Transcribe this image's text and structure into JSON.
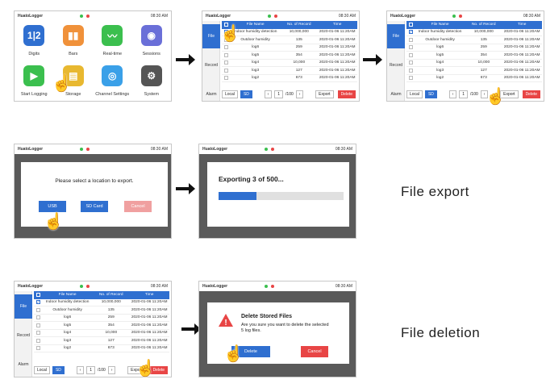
{
  "status": {
    "brand": "HuatoLogger",
    "time": "08:30 AM"
  },
  "home": {
    "apps": [
      {
        "label": "Digits",
        "glyph": "1|2",
        "color": "#2f6fd0"
      },
      {
        "label": "Bars",
        "glyph": "▮▮",
        "color": "#f0913a"
      },
      {
        "label": "Real-time",
        "glyph": "〰",
        "color": "#3bbf4e"
      },
      {
        "label": "Sessions",
        "glyph": "◉",
        "color": "#6a6fd8"
      },
      {
        "label": "Start Logging",
        "glyph": "▶",
        "color": "#3bbf4e"
      },
      {
        "label": "Storage",
        "glyph": "▤",
        "color": "#e8b830"
      },
      {
        "label": "Channel Settings",
        "glyph": "◎",
        "color": "#3aa0e8"
      },
      {
        "label": "System",
        "glyph": "⚙",
        "color": "#555555"
      }
    ]
  },
  "files": {
    "tabs": [
      "File",
      "Record",
      "Alarm"
    ],
    "headers": [
      "File Name",
      "No. of Record",
      "Time"
    ],
    "rows": [
      {
        "name": "Indoor humidity detection",
        "count": "10,000,000",
        "time": "2020-01-06 11:20AM"
      },
      {
        "name": "Outdoor humidity",
        "count": "135",
        "time": "2020-01-06 11:20AM"
      },
      {
        "name": "log6",
        "count": "259",
        "time": "2020-01-06 11:20AM"
      },
      {
        "name": "log5",
        "count": "354",
        "time": "2020-01-06 11:20AM"
      },
      {
        "name": "log4",
        "count": "10,000",
        "time": "2020-01-06 11:20AM"
      },
      {
        "name": "log3",
        "count": "127",
        "time": "2020-01-06 11:20AM"
      },
      {
        "name": "log2",
        "count": "673",
        "time": "2020-01-06 11:20AM"
      }
    ],
    "local_label": "Local",
    "sd_label": "SD",
    "page": "1",
    "page_total": "/100",
    "export_label": "Export",
    "delete_label": "Delete"
  },
  "export_dialog": {
    "prompt": "Please select a location to export.",
    "usb": "USB",
    "sd": "SD Card",
    "cancel": "Cancel"
  },
  "progress": {
    "text": "Exporting 3 of 500...",
    "fraction": 0.3
  },
  "delete_dialog": {
    "title": "Delete Stored Files",
    "body1": "Are you sure you want to delete the selected",
    "body2": "5 log files.",
    "delete": "Delete",
    "cancel": "Cancel"
  },
  "captions": {
    "export": "File export",
    "delete": "File deletion"
  },
  "colors": {
    "accent": "#2f6fd0",
    "danger": "#e84545"
  }
}
